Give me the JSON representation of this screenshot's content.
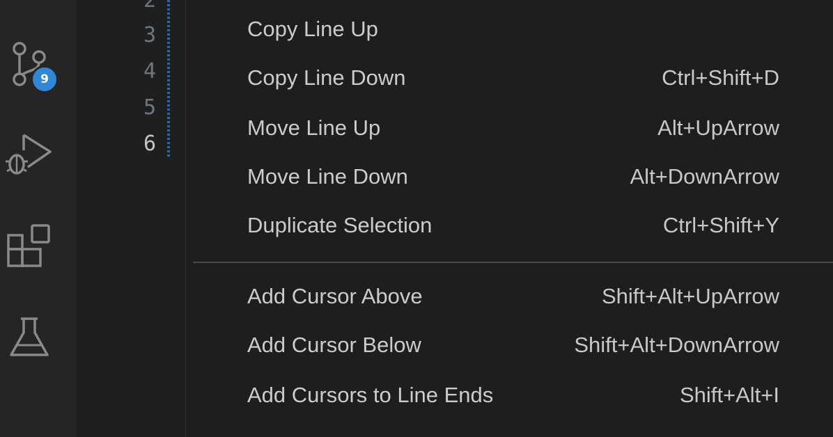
{
  "activity_bar": {
    "source_control_badge": "9",
    "icons": [
      "source-control-icon",
      "run-debug-icon",
      "extensions-icon",
      "testing-icon"
    ]
  },
  "editor": {
    "line_numbers": [
      "2",
      "3",
      "4",
      "5",
      "6"
    ],
    "active_line": "6"
  },
  "context_menu": {
    "groups": [
      {
        "items": [
          {
            "label": "Copy Line Up",
            "shortcut": ""
          },
          {
            "label": "Copy Line Down",
            "shortcut": "Ctrl+Shift+D"
          },
          {
            "label": "Move Line Up",
            "shortcut": "Alt+UpArrow"
          },
          {
            "label": "Move Line Down",
            "shortcut": "Alt+DownArrow"
          },
          {
            "label": "Duplicate Selection",
            "shortcut": "Ctrl+Shift+Y"
          }
        ]
      },
      {
        "items": [
          {
            "label": "Add Cursor Above",
            "shortcut": "Shift+Alt+UpArrow"
          },
          {
            "label": "Add Cursor Below",
            "shortcut": "Shift+Alt+DownArrow"
          },
          {
            "label": "Add Cursors to Line Ends",
            "shortcut": "Shift+Alt+I"
          }
        ]
      }
    ]
  },
  "colors": {
    "badge": "#2f87d6",
    "menu_background": "#1e1e1e",
    "activity_bar": "#252526"
  }
}
